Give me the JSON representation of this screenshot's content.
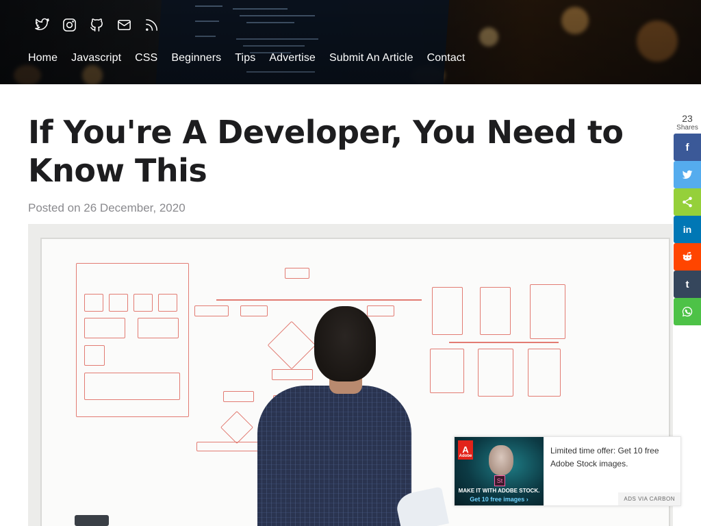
{
  "header": {
    "social_icons": [
      "twitter-icon",
      "instagram-icon",
      "github-icon",
      "mail-icon",
      "rss-icon"
    ],
    "nav": [
      "Home",
      "Javascript",
      "CSS",
      "Beginners",
      "Tips",
      "Advertise",
      "Submit An Article",
      "Contact"
    ]
  },
  "article": {
    "title": "If You're A Developer, You Need to Know This",
    "posted": "Posted on 26 December, 2020"
  },
  "share": {
    "count": "23",
    "label": "Shares",
    "buttons": [
      {
        "name": "facebook",
        "icon": "facebook-icon",
        "glyph": "f",
        "color": "#3b5998"
      },
      {
        "name": "twitter",
        "icon": "twitter-icon",
        "glyph": "",
        "color": "#55acee"
      },
      {
        "name": "share",
        "icon": "share-icon",
        "glyph": "",
        "color": "#95d03a"
      },
      {
        "name": "linkedin",
        "icon": "linkedin-icon",
        "glyph": "in",
        "color": "#0077b5"
      },
      {
        "name": "reddit",
        "icon": "reddit-icon",
        "glyph": "",
        "color": "#ff4500"
      },
      {
        "name": "tumblr",
        "icon": "tumblr-icon",
        "glyph": "t",
        "color": "#35465c"
      },
      {
        "name": "whatsapp",
        "icon": "whatsapp-icon",
        "glyph": "",
        "color": "#4dc247"
      }
    ]
  },
  "ad": {
    "text": "Limited time offer: Get 10 free Adobe Stock images.",
    "image_line1": "MAKE IT WITH ADOBE STOCK.",
    "image_line2": "Get 10 free images ›",
    "brand": "Adobe",
    "brand_mark": "A",
    "app_mark": "St",
    "via": "ADS VIA CARBON"
  }
}
